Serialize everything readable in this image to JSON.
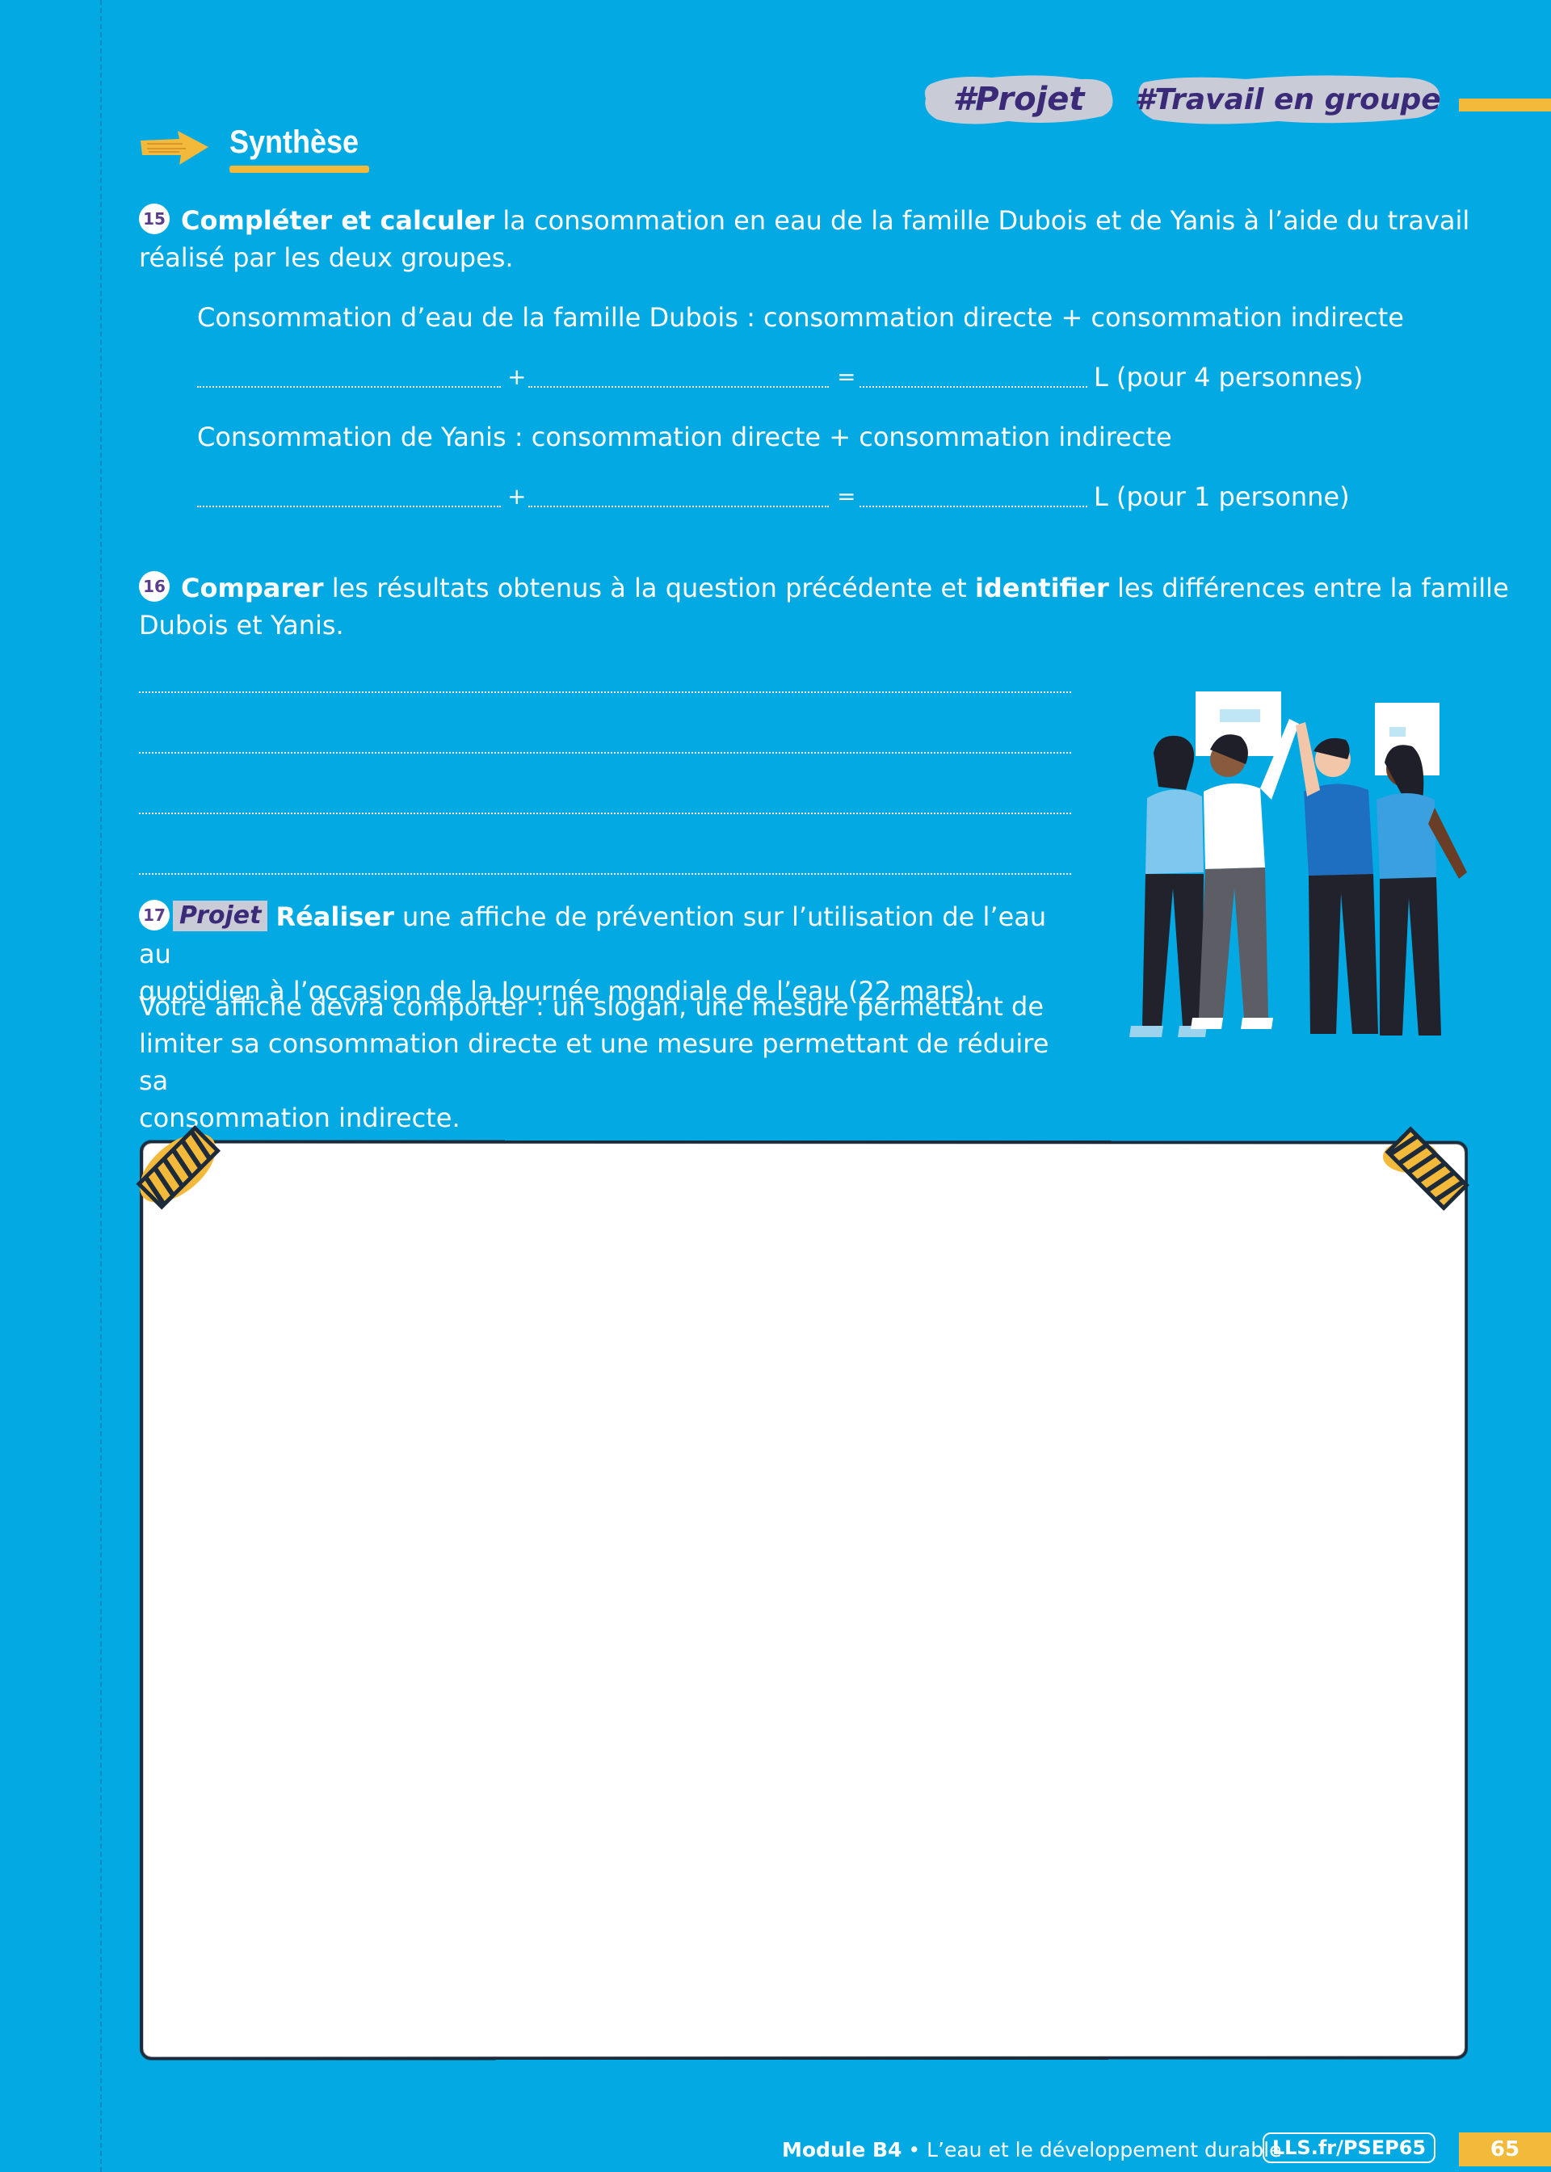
{
  "tags": {
    "projet": "#Projet",
    "groupe": "#Travail en groupe"
  },
  "section": {
    "title": "Synthèse"
  },
  "q15": {
    "number": "15",
    "bold": "Compléter et calculer",
    "text_line1": " la consommation en eau de la famille Dubois et de Yanis à l’aide du travail",
    "text_line2": "réalisé par les deux groupes.",
    "dubois_label": "Consommation d’eau de la famille Dubois : consommation directe + consommation indirecte",
    "yanis_label": "Consommation de Yanis : consommation directe + consommation indirecte",
    "plus": "+",
    "equals": "=",
    "dubois_unit": "L (pour 4 personnes)",
    "yanis_unit": "L (pour 1 personne)"
  },
  "q16": {
    "number": "16",
    "bold1": "Comparer",
    "text1": " les résultats obtenus à la question précédente et ",
    "bold2": "identifier",
    "text2": " les différences entre la famille",
    "text_line2": "Dubois et Yanis."
  },
  "q17": {
    "number": "17",
    "project_label": "Projet",
    "bold": "Réaliser",
    "text_line1": " une affiche de prévention sur l’utilisation de l’eau au",
    "text_line2": "quotidien à l’occasion de la Journée mondiale de l’eau (22 mars).",
    "instructions_line1": "Votre affiche devra comporter : un slogan, une mesure permettant de",
    "instructions_line2": "limiter sa consommation directe et une mesure permettant de réduire sa",
    "instructions_line3": "consommation indirecte."
  },
  "footer": {
    "module": "Module B4",
    "separator": " • ",
    "subject": "L’eau et le développement durable",
    "link": "LLS.fr/PSEP65",
    "page": "65"
  },
  "colors": {
    "background": "#03a9e2",
    "accent": "#f3b93a",
    "tag_text": "#3b2a78"
  }
}
